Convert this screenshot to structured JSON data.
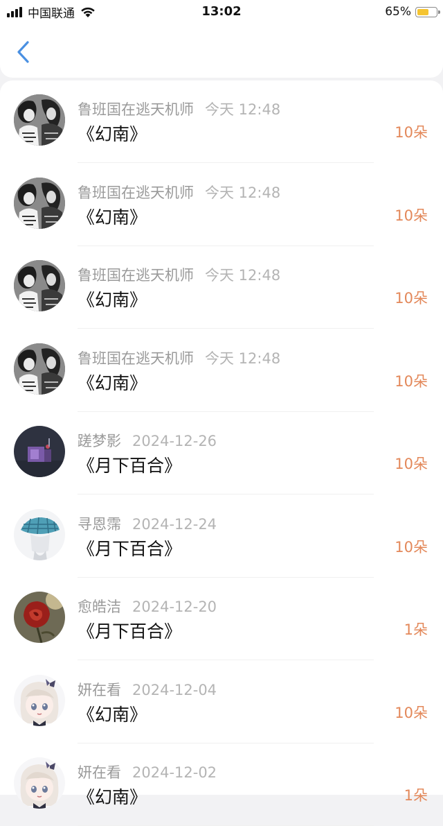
{
  "status_bar": {
    "carrier": "中国联通",
    "time": "13:02",
    "battery_percent": "65%",
    "battery_level": 0.65,
    "battery_color": "#f5c431"
  },
  "nav": {
    "back_icon": "chevron-left-icon",
    "accent_color": "#4a90e2"
  },
  "records": [
    {
      "name": "鲁班国在逃天机师",
      "time": "今天 12:48",
      "title": "《幻南》",
      "amount": "10朵",
      "avatar": "bw-anime-avatar"
    },
    {
      "name": "鲁班国在逃天机师",
      "time": "今天 12:48",
      "title": "《幻南》",
      "amount": "10朵",
      "avatar": "bw-anime-avatar"
    },
    {
      "name": "鲁班国在逃天机师",
      "time": "今天 12:48",
      "title": "《幻南》",
      "amount": "10朵",
      "avatar": "bw-anime-avatar"
    },
    {
      "name": "鲁班国在逃天机师",
      "time": "今天 12:48",
      "title": "《幻南》",
      "amount": "10朵",
      "avatar": "bw-anime-avatar"
    },
    {
      "name": "蹉梦影",
      "time": "2024-12-26",
      "title": "《月下百合》",
      "amount": "10朵",
      "avatar": "night-room-avatar"
    },
    {
      "name": "寻恩霈",
      "time": "2024-12-24",
      "title": "《月下百合》",
      "amount": "10朵",
      "avatar": "plaid-cap-avatar"
    },
    {
      "name": "愈皓洁",
      "time": "2024-12-20",
      "title": "《月下百合》",
      "amount": "1朵",
      "avatar": "red-rose-avatar"
    },
    {
      "name": "妍在看",
      "time": "2024-12-04",
      "title": "《幻南》",
      "amount": "10朵",
      "avatar": "anime-girl-avatar"
    },
    {
      "name": "妍在看",
      "time": "2024-12-02",
      "title": "《幻南》",
      "amount": "1朵",
      "avatar": "anime-girl-avatar"
    }
  ],
  "colors": {
    "amount": "#e3885a",
    "name": "#9a9a9a",
    "title": "#111111"
  }
}
